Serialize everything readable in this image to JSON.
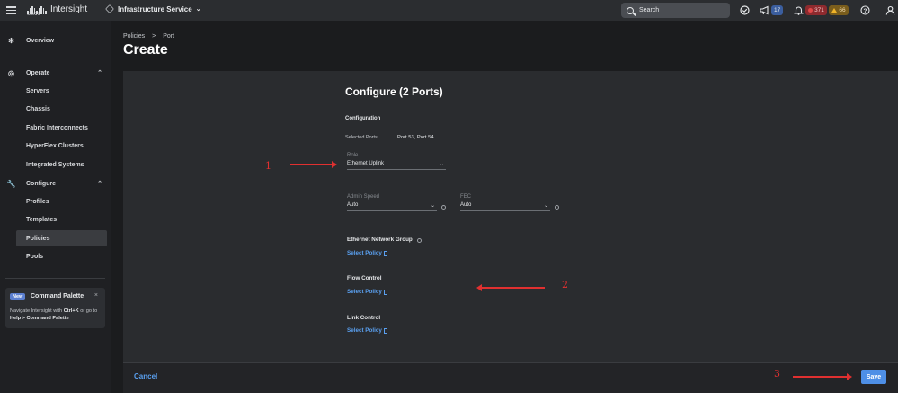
{
  "topbar": {
    "brand": "cisco",
    "app_name": "Intersight",
    "service": "Infrastructure Service",
    "search_placeholder": "Search",
    "notifications_count": "17",
    "alarms_critical": "371",
    "alarms_warning": "66"
  },
  "sidebar": {
    "overview": "Overview",
    "operate": "Operate",
    "operate_items": [
      "Servers",
      "Chassis",
      "Fabric Interconnects",
      "HyperFlex Clusters",
      "Integrated Systems"
    ],
    "configure": "Configure",
    "configure_items": [
      "Profiles",
      "Templates",
      "Policies",
      "Pools"
    ],
    "command_palette": {
      "new_badge": "New",
      "title": "Command Palette",
      "desc_1": "Navigate Intersight with ",
      "shortcut": "Ctrl+K",
      "desc_2": " or go to ",
      "help_path": "Help > Command Palette"
    }
  },
  "header": {
    "breadcrumb": [
      "Policies",
      "Port"
    ],
    "separator": ">",
    "title": "Create"
  },
  "form": {
    "title": "Configure (2 Ports)",
    "configuration_label": "Configuration",
    "selected_ports_label": "Selected Ports",
    "selected_ports_value": "Port 53, Port 54",
    "role_label": "Role",
    "role_value": "Ethernet Uplink",
    "admin_speed_label": "Admin Speed",
    "admin_speed_value": "Auto",
    "fec_label": "FEC",
    "fec_value": "Auto",
    "ethernet_network_group_label": "Ethernet Network Group",
    "flow_control_label": "Flow Control",
    "link_control_label": "Link Control",
    "select_policy_label": "Select Policy"
  },
  "footer": {
    "cancel_label": "Cancel",
    "save_label": "Save"
  },
  "annotations": {
    "n1": "1",
    "n2": "2",
    "n3": "3",
    "color": "#e03030"
  }
}
